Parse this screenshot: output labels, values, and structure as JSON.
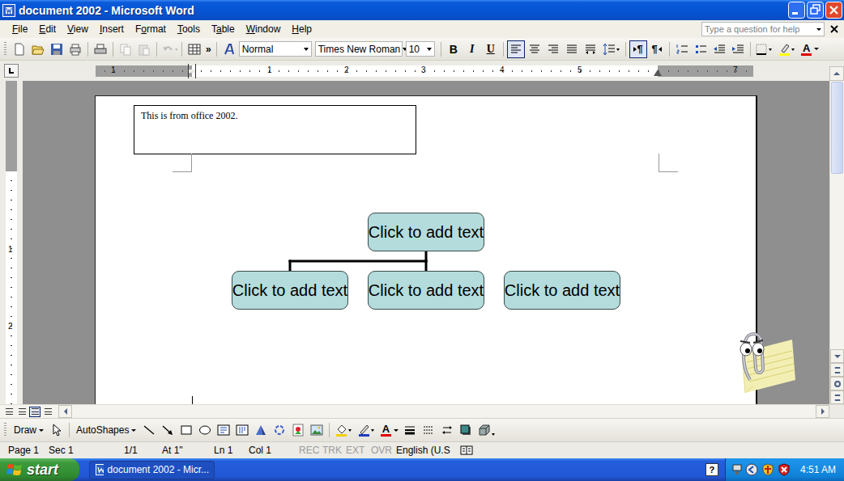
{
  "window": {
    "title": "document 2002 - Microsoft Word"
  },
  "menu": [
    {
      "label": "File",
      "underline": 0
    },
    {
      "label": "Edit",
      "underline": 0
    },
    {
      "label": "View",
      "underline": 0
    },
    {
      "label": "Insert",
      "underline": 0
    },
    {
      "label": "Format",
      "underline": 1
    },
    {
      "label": "Tools",
      "underline": 0
    },
    {
      "label": "Table",
      "underline": 1
    },
    {
      "label": "Window",
      "underline": 0
    },
    {
      "label": "Help",
      "underline": 0
    }
  ],
  "help_box": {
    "placeholder": "Type a question for help"
  },
  "toolbar": {
    "overflow": "»",
    "style": "Normal",
    "font": "Times New Roman",
    "size": "10",
    "bold": "B",
    "italic": "I",
    "underline": "U",
    "align": [
      {
        "selected": true
      },
      {
        "selected": false
      },
      {
        "selected": false
      },
      {
        "selected": false
      }
    ],
    "direction": [
      {
        "glyph": "¶",
        "selected": true
      },
      {
        "glyph": "¶",
        "selected": false
      }
    ],
    "font_color": "A"
  },
  "ruler": {
    "horizontal": [
      "1",
      "1",
      "2",
      "3",
      "4",
      "5",
      "7"
    ],
    "vertical": [
      "1",
      "2"
    ]
  },
  "document": {
    "text_box": "This is from office 2002.",
    "diagram": {
      "root": "Click to add text",
      "children": [
        {
          "text": "Click to add text",
          "connected": true
        },
        {
          "text": "Click to add text",
          "connected": true
        },
        {
          "text": "Click to add text",
          "connected": false
        }
      ]
    }
  },
  "drawing_toolbar": {
    "draw": "Draw",
    "autoshapes": "AutoShapes"
  },
  "status_bar": [
    {
      "text": "Page 1",
      "disabled": false
    },
    {
      "text": "Sec 1",
      "disabled": false
    },
    {
      "text": "1/1",
      "disabled": false
    },
    {
      "text": "At 1\"",
      "disabled": false
    },
    {
      "text": "Ln 1",
      "disabled": false
    },
    {
      "text": "Col 1",
      "disabled": false
    },
    {
      "text": "REC",
      "disabled": true
    },
    {
      "text": "TRK",
      "disabled": true
    },
    {
      "text": "EXT",
      "disabled": true
    },
    {
      "text": "OVR",
      "disabled": true
    },
    {
      "text": "English (U.S",
      "disabled": false
    }
  ],
  "taskbar": {
    "start": "start",
    "tasks": [
      {
        "label": "document 2002 - Micr...",
        "selected": true
      }
    ],
    "tray_help": "?",
    "clock": "4:51 AM"
  }
}
